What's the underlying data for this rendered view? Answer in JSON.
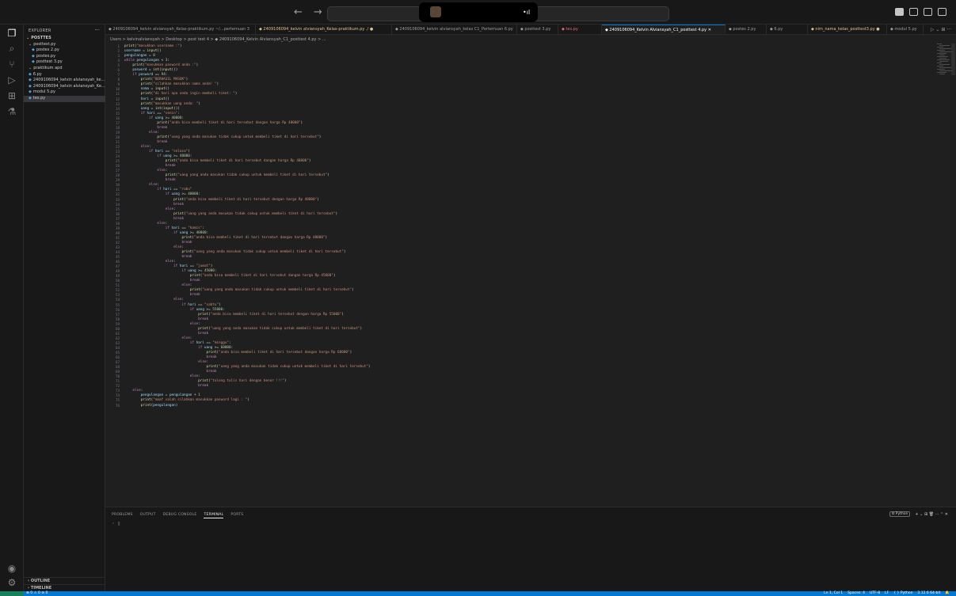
{
  "titlebar": {
    "back": "←",
    "forward": "→",
    "notch_signal": "•ıl"
  },
  "sidebar": {
    "title": "EXPLORER",
    "more": "···",
    "root": "POSTTES",
    "items": [
      {
        "label": "posttest.py",
        "kind": "folder"
      },
      {
        "label": "postes 2.py",
        "kind": "file"
      },
      {
        "label": "postes.py",
        "kind": "file"
      },
      {
        "label": "posttest 3.py",
        "kind": "file"
      },
      {
        "label": "praktikum apd",
        "kind": "folder"
      },
      {
        "label": "6.py",
        "kind": "file"
      },
      {
        "label": "2409106094_kelvin alviansyah_ke...",
        "kind": "file"
      },
      {
        "label": "2409106094_kelvin alviansyah_Ke...",
        "kind": "file"
      },
      {
        "label": "modul 5.py",
        "kind": "file"
      },
      {
        "label": "tes.py",
        "kind": "file"
      }
    ],
    "outline": "OUTLINE",
    "timeline": "TIMELINE"
  },
  "tabs": [
    {
      "label": "◆ 2409106094_kelvin alviansyah_Kelas-praktikum.py ~/...pertemuan 3"
    },
    {
      "label": "◆ 2409106094_kelvin alviansyah_Kelas-praktikum.py ./  ●"
    },
    {
      "label": "◆ 2409106094_kelvin alviansyah_kelas C1_Pertemuan 6.py"
    },
    {
      "label": "◆ posttest 3.py"
    },
    {
      "label": "◆ tes.py"
    },
    {
      "label": "◆ 2409106094_Kelvin Alviansyah_C1_posttest 4.py  ✕"
    },
    {
      "label": "◆ postes 2.py"
    },
    {
      "label": "◆ 6.py"
    },
    {
      "label": "◆ nim_nama_kelas_posttest3.py  ●"
    },
    {
      "label": "◆ modul 5.py"
    }
  ],
  "tab_actions": "▷ ⌄ ⊞ ···",
  "breadcrumb": "Users > kelvinalviansyah > Desktop > post test 4 > ◆ 2409106094_Kelvin Alviansyah_C1_posttest 4.py > ...",
  "code": [
    "print(\"masukkan username :\")",
    "username = input()",
    "pengulangan = 0",
    "while pengulangan < 3:",
    "    print(\"masukkan pasword anda :\")",
    "    pasword = int(input())",
    "    if pasword == 94:",
    "        print(\"BERHASIL MASUK\")",
    "        print(\"silahkan masukkan nama anda! \")",
    "        nama = input()",
    "        print(\"di hari apa anda ingin membeli tiket: \")",
    "        hari = input()",
    "        print(\"masukkan uang anda: \")",
    "        uang = int(input())",
    "        if hari == \"senin\":",
    "            if uang >= 40000:",
    "                print(\"anda bisa membeli tiket di hari tersebut dangan harga Rp 40000\")",
    "                break",
    "            else:",
    "                print(\"uang yang anda masukan tidak cukup untuk membeli tiket di hari tersebut\")",
    "                break",
    "        else:",
    "            if hari == \"selasa\")",
    "                if uang >= 40000:",
    "                    print(\"anda bisa membeli tiket di hari tersebut dangan harga Rp 40000\")",
    "                    break",
    "                else:",
    "                    print(\"uang yang anda masukan tidak cukup untuk membeli tiket di hari tersebut\")",
    "                    break",
    "            else:",
    "                if hari == \"rabu\"",
    "                    if uang >= 40000:",
    "                        print(\"anda bisa membeli tiket di hari tersebut dengan harga Rp 40000\")",
    "                        break",
    "                    else:",
    "                        print(\"uang yang anda masukan tidak cukup untuk membeli tiket di hari tersebut\")",
    "                        break",
    "                else:",
    "                    if hari == \"kamis\":",
    "                        if uang >= 40000:",
    "                            print(\"anda bisa membeli tiket di hari tersebut dangan harga Rp 40000\")",
    "                            break",
    "                        else:",
    "                            print(\"uang yang anda masukan tidak cukup untuk membeli tiket di hari tersebut\")",
    "                            break",
    "                    else:",
    "                        if hari == \"jumat\")",
    "                            if uang >= 45000:",
    "                                print(\"anda bisa membeli tiket di hari tersebut dangan harga Rp 45000\")",
    "                                break",
    "                            else:",
    "                                print(\"uang yang anda masukan tidak cukup untuk membeli tiket di hari tersebut\")",
    "                                break",
    "                        else:",
    "                            if hari == \"sabtu\")",
    "                                if uang >= 55000:",
    "                                    print(\"anda bisa membeli tiket di hari tersebut dengan harga Rp 55000\")",
    "                                    break",
    "                                else:",
    "                                    print(\"uang yang anda masukan tidak cukup untuk membeli tiket di hari tersebut\")",
    "                                    break",
    "                            else:",
    "                                if hari == \"minggu\":",
    "                                    if uang >= 60000:",
    "                                        print(\"anda bisa membeli tiket di hari tersebut dangan harga Rp 60000\")",
    "                                        break",
    "                                    else:",
    "                                        print(\"uang yang anda masukan tidak cukup untuk membeli tiket di hari tersebut\")",
    "                                        break",
    "                                else:",
    "                                    print(\"tolong tulis hari dengan benar !!!\")",
    "                                    break",
    "    else:",
    "        pengulangan = pengulangan + 1",
    "        print(\"maaf salah silahkan masukkan pasword lagi : \")",
    "        print(pengulangan)"
  ],
  "panel": {
    "tabs": [
      "PROBLEMS",
      "OUTPUT",
      "DEBUG CONSOLE",
      "TERMINAL",
      "PORTS"
    ],
    "active_tab": "TERMINAL",
    "prompt": "◦ ▯",
    "terminal_label": "Python",
    "tools": "+ ⌄ ⊞ 🗑 ··· ⌃ ✕"
  },
  "status": {
    "left": "⊗ 0 ⚠ 0   ⊘ 0",
    "right": [
      "Ln 1, Col 1",
      "Spaces: 4",
      "UTF-8",
      "LF",
      "{ } Python",
      "3.12.6 64-bit",
      "🔔"
    ]
  },
  "colors": {
    "keyword": "#c586c0",
    "builtin": "#dcdcaa",
    "string": "#ce9178",
    "number": "#b5cea8",
    "variable": "#9cdcfe",
    "accent": "#0078d4"
  }
}
